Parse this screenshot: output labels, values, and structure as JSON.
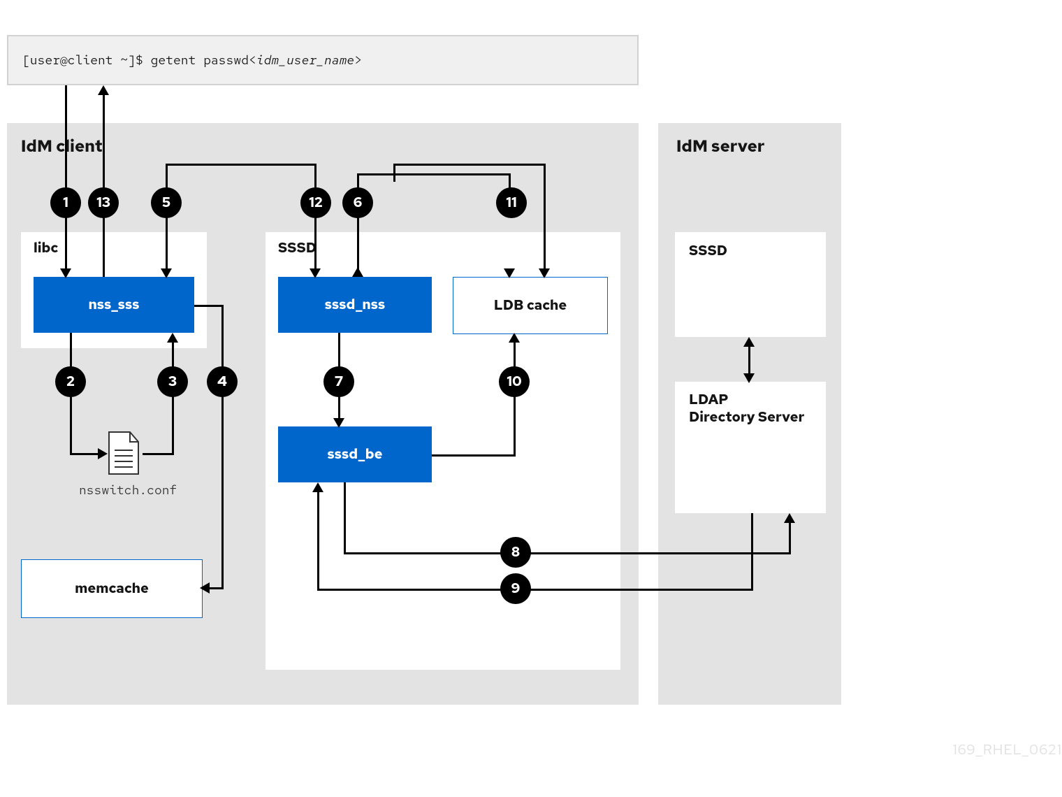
{
  "command": {
    "prefix": "[user@client ~]$ getent passwd ",
    "arg_open": "<",
    "arg": "idm_user_name",
    "arg_close": ">"
  },
  "client": {
    "title": "IdM client",
    "libc_label": "libc",
    "sssd_label": "SSSD",
    "nodes": {
      "nss_sss": "nss_sss",
      "sssd_nss": "sssd_nss",
      "sssd_be": "sssd_be",
      "ldb_cache": "LDB cache",
      "memcache": "memcache",
      "nsswitch_conf": "nsswitch.conf"
    }
  },
  "server": {
    "title": "IdM server",
    "sssd_label": "SSSD",
    "ldap_label_line1": "LDAP",
    "ldap_label_line2": "Directory Server"
  },
  "steps": {
    "s1": "1",
    "s2": "2",
    "s3": "3",
    "s4": "4",
    "s5": "5",
    "s6": "6",
    "s7": "7",
    "s8": "8",
    "s9": "9",
    "s10": "10",
    "s11": "11",
    "s12": "12",
    "s13": "13"
  },
  "footer_ref": "169_RHEL_0621"
}
